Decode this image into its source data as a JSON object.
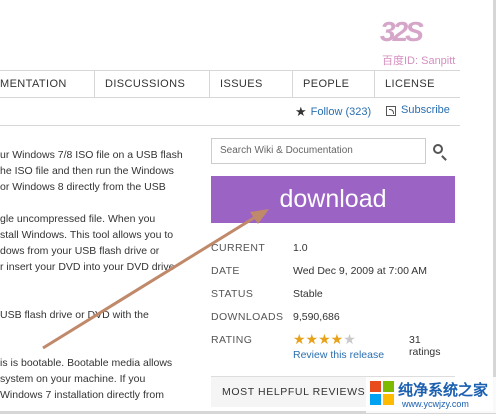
{
  "tabs": [
    "MENTATION",
    "DISCUSSIONS",
    "ISSUES",
    "PEOPLE",
    "LICENSE"
  ],
  "follow": {
    "label": "Follow (323)",
    "subscribe": "Subscribe"
  },
  "search": {
    "placeholder": "Search Wiki & Documentation"
  },
  "download": {
    "label": "download"
  },
  "properties": [
    {
      "label": "CURRENT",
      "value": "1.0"
    },
    {
      "label": "DATE",
      "value": "Wed Dec 9, 2009 at 7:00 AM"
    },
    {
      "label": "STATUS",
      "value": "Stable"
    },
    {
      "label": "DOWNLOADS",
      "value": "9,590,686"
    }
  ],
  "rating": {
    "label": "RATING",
    "stars": 4.5,
    "count_text": "31 ratings",
    "review_link": "Review this release"
  },
  "helpful": {
    "label": "MOST HELPFUL REVIEWS"
  },
  "left_text": [
    "ur Windows 7/8 ISO file on a USB flash",
    "he ISO file and then run the Windows",
    "or Windows 8 directly from the USB",
    "",
    "gle uncompressed file. When you",
    "stall Windows. This tool allows you to",
    "dows from your USB flash drive or",
    "r insert your DVD into your DVD drive",
    "",
    "",
    "USB flash drive or DVD with the",
    "",
    "",
    "is is bootable. Bootable media allows",
    "system on your machine. If you",
    "Windows 7 installation directly from"
  ],
  "watermark": {
    "logo": "32S",
    "id_text": "百度ID: Sanpitt",
    "site_title": "纯净系统之家",
    "site_url": "www.ycwjzy.com"
  },
  "colors": {
    "download_bg": "#9b63c4",
    "link": "#2a6fb0",
    "arrow": "#c0896a",
    "star": "#e8a21a"
  }
}
